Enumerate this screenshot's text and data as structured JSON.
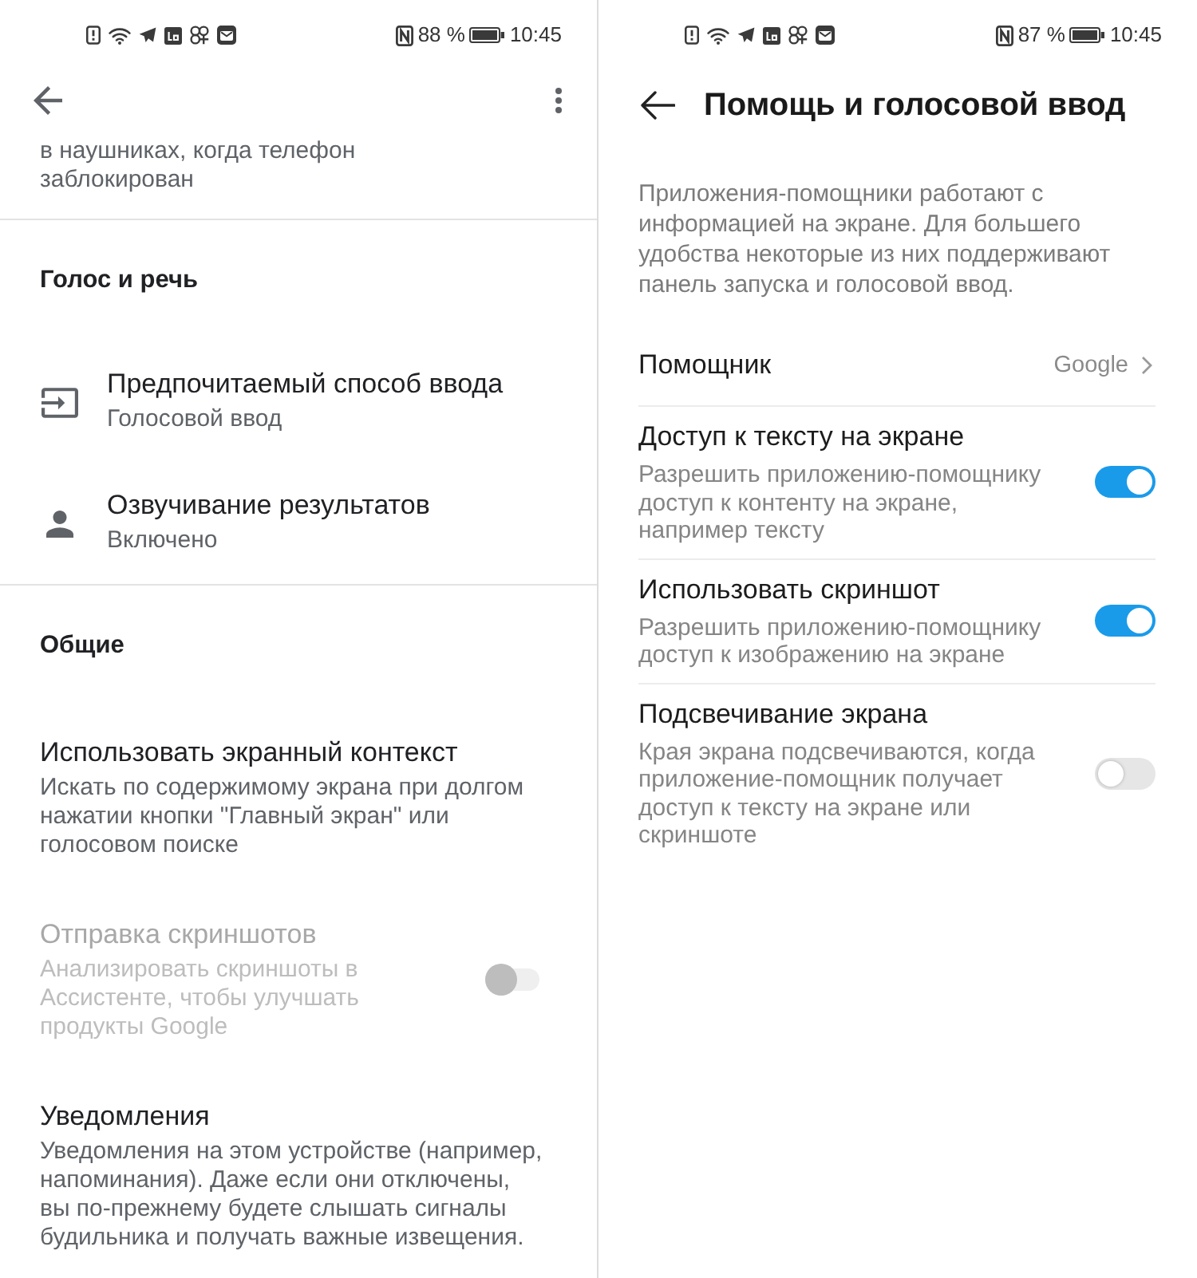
{
  "left_screen": {
    "status_bar": {
      "battery_percent": "88 %",
      "time": "10:45"
    },
    "partial_text": "в наушниках, когда телефон заблокирован",
    "sections": [
      {
        "header": "Голос и речь",
        "items": [
          {
            "kind": "icon_item",
            "title": "Предпочитаемый способ ввода",
            "subtitle": "Голосовой ввод"
          },
          {
            "kind": "icon_item",
            "title": "Озвучивание результатов",
            "subtitle": "Включено"
          }
        ]
      },
      {
        "header": "Общие",
        "items": [
          {
            "kind": "text_item",
            "title": "Использовать экранный контекст",
            "description": "Искать по содержимому экрана при долгом нажатии кнопки \"Главный экран\" или голосовом поиске",
            "disabled": false
          },
          {
            "kind": "switch_item",
            "title": "Отправка скриншотов",
            "description": "Анализировать скриншоты в Ассистенте, чтобы улучшать продукты Google",
            "disabled": true,
            "on": false
          },
          {
            "kind": "text_item",
            "title": "Уведомления",
            "description": "Уведомления на этом устройстве (например, напоминания). Даже если они отключены, вы по-прежнему будете слышать сигналы будильника и получать важные извещения.",
            "disabled": false
          }
        ]
      }
    ]
  },
  "right_screen": {
    "status_bar": {
      "battery_percent": "87 %",
      "time": "10:45"
    },
    "title": "Помощь и голосовой ввод",
    "intro": "Приложения-помощники работают с информацией на экране. Для большего удобства некоторые из них поддерживают панель запуска и голосовой ввод.",
    "settings": [
      {
        "kind": "link",
        "title": "Помощник",
        "value": "Google"
      },
      {
        "kind": "switch",
        "title": "Доступ к тексту на экране",
        "description": "Разрешить приложению-помощнику доступ к контенту на экране, например тексту",
        "on": true
      },
      {
        "kind": "switch",
        "title": "Использовать скриншот",
        "description": "Разрешить приложению-помощнику доступ к изображению на экране",
        "on": true
      },
      {
        "kind": "switch",
        "title": "Подсвечивание экрана",
        "description": "Края экрана подсвечиваются, когда приложение-помощник получает доступ к тексту на экране или скриншоте",
        "on": false
      }
    ]
  }
}
